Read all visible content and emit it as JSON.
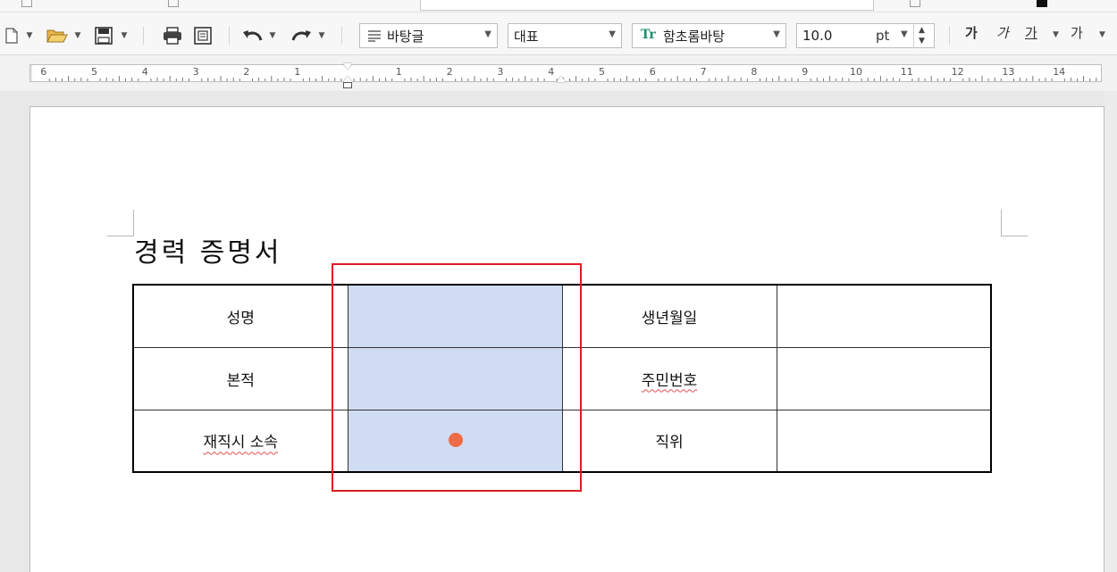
{
  "toolbar": {
    "style_value": "바탕글",
    "language_value": "대표",
    "font_value": "함초롬바탕",
    "size_value": "10.0",
    "size_unit": "pt",
    "bold_label": "가",
    "italic_label": "가",
    "underline_label": "가",
    "strike_label": "가",
    "font_icon_text": "Tr"
  },
  "ruler": {
    "left_marks": [
      "6",
      "5",
      "4",
      "3",
      "2",
      "1"
    ],
    "right_marks": [
      "1",
      "2",
      "3",
      "4",
      "5",
      "6",
      "7",
      "8",
      "9",
      "10",
      "11",
      "12",
      "13",
      "14"
    ]
  },
  "document": {
    "title": "경력 증명서",
    "table": {
      "rows": [
        {
          "label1": "성명",
          "value1": "",
          "label2": "생년월일",
          "value2": ""
        },
        {
          "label1": "본적",
          "value1": "",
          "label2": "주민번호",
          "value2": ""
        },
        {
          "label1": "재직시 소속",
          "value1": "",
          "label2": "직위",
          "value2": ""
        }
      ]
    }
  },
  "colors": {
    "selection": "#d0dcf3",
    "highlight_border": "#e01b24",
    "click_marker": "#ef6b48"
  }
}
